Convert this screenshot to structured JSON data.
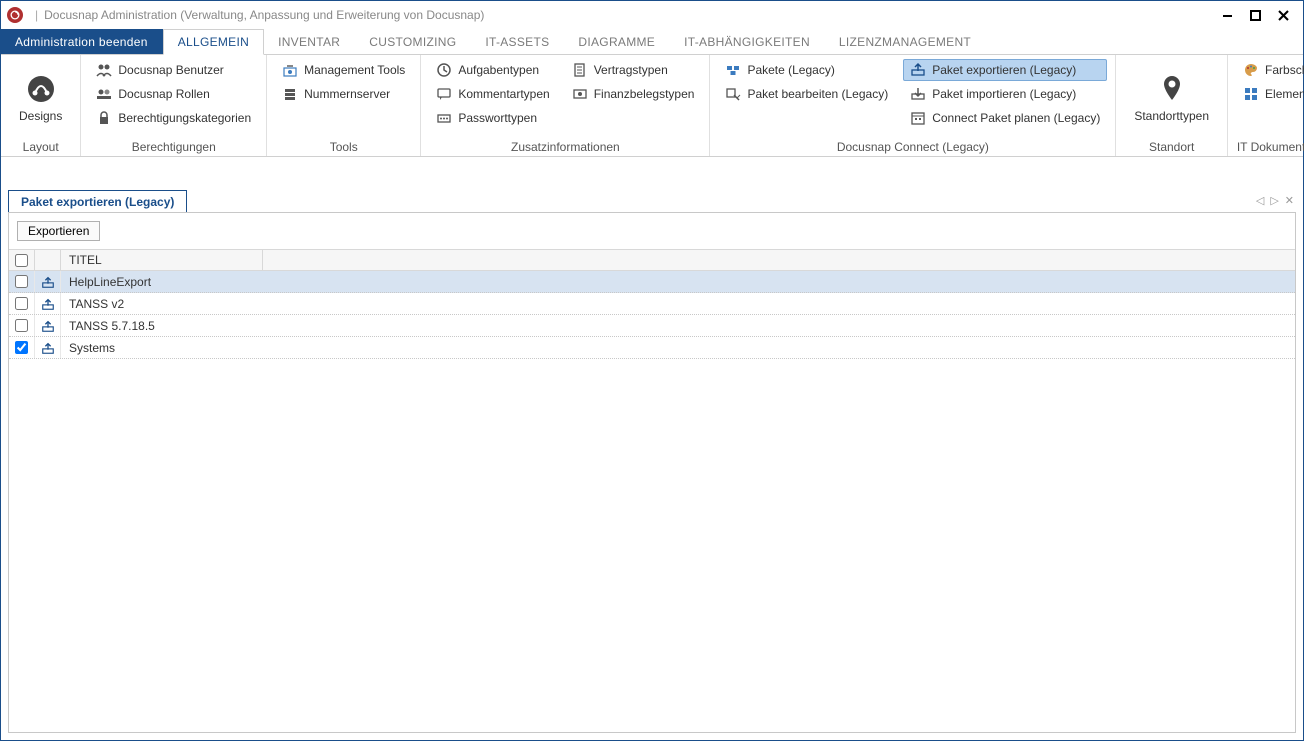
{
  "title": "Docusnap Administration (Verwaltung, Anpassung und Erweiterung von Docusnap)",
  "tabs": {
    "admin_end": "Administration beenden",
    "items": [
      "ALLGEMEIN",
      "INVENTAR",
      "CUSTOMIZING",
      "IT-ASSETS",
      "DIAGRAMME",
      "IT-ABHÄNGIGKEITEN",
      "LIZENZMANAGEMENT"
    ],
    "active_index": 0
  },
  "ribbon": {
    "designs": {
      "label": "Designs",
      "group": "Layout"
    },
    "permissions": {
      "group": "Berechtigungen",
      "items": [
        "Docusnap Benutzer",
        "Docusnap Rollen",
        "Berechtigungskategorien"
      ]
    },
    "tools": {
      "group": "Tools",
      "items": [
        "Management Tools",
        "Nummernserver"
      ]
    },
    "extra": {
      "group": "Zusatzinformationen",
      "col1": [
        "Aufgabentypen",
        "Kommentartypen",
        "Passworttypen"
      ],
      "col2": [
        "Vertragstypen",
        "Finanzbelegstypen"
      ]
    },
    "connect": {
      "group": "Docusnap Connect (Legacy)",
      "col1": [
        "Pakete (Legacy)",
        "Paket bearbeiten (Legacy)"
      ],
      "col2": [
        "Paket exportieren (Legacy)",
        "Paket importieren (Legacy)",
        "Connect Paket planen (Legacy)"
      ],
      "selected": "Paket exportieren (Legacy)"
    },
    "location": {
      "label": "Standorttypen",
      "group": "Standort"
    },
    "framework": {
      "group": "IT Dokumentation Framework",
      "items": [
        "Farbschema",
        "Element Eigenschaften"
      ]
    }
  },
  "subtab": "Paket exportieren (Legacy)",
  "export_btn": "Exportieren",
  "table": {
    "header_title": "TITEL",
    "rows": [
      {
        "title": "HelpLineExport",
        "checked": false,
        "selected": true
      },
      {
        "title": "TANSS v2",
        "checked": false,
        "selected": false
      },
      {
        "title": "TANSS 5.7.18.5",
        "checked": false,
        "selected": false
      },
      {
        "title": "Systems",
        "checked": true,
        "selected": false
      }
    ]
  }
}
